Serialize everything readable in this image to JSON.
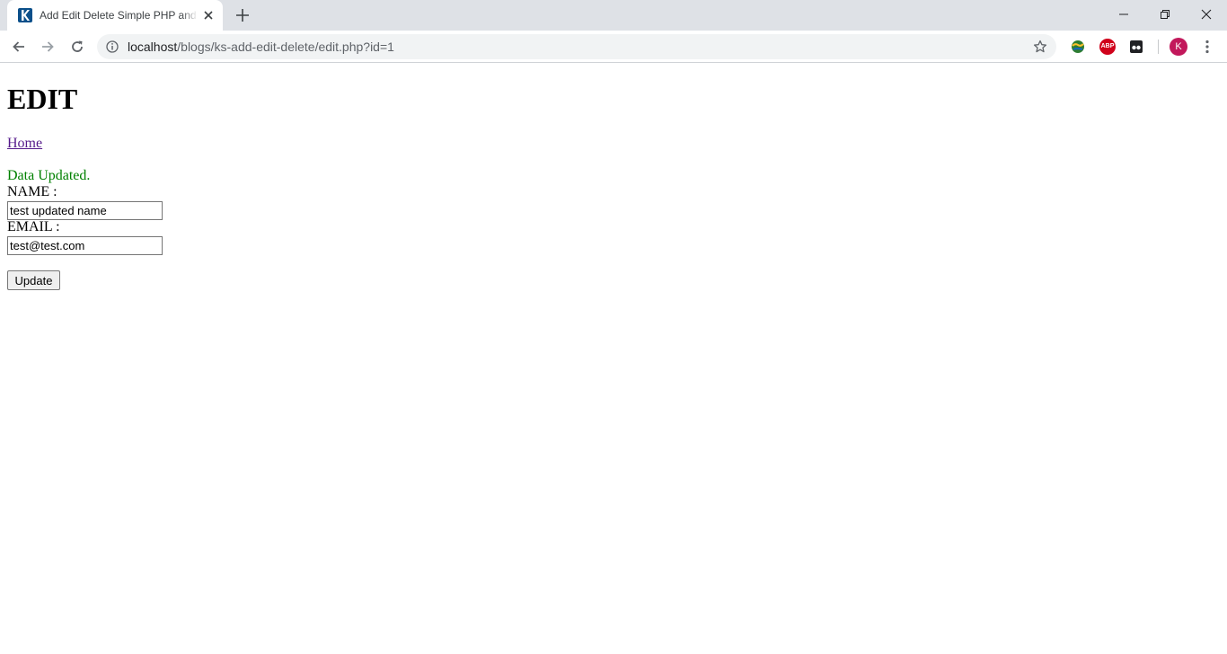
{
  "browser": {
    "tab_title": "Add Edit Delete Simple PHP and MySQL",
    "url_host": "localhost",
    "url_path": "/blogs/ks-add-edit-delete/edit.php?id=1",
    "avatar_initial": "K",
    "abp_label": "ABP",
    "icons": {
      "favicon": "k-logo-icon",
      "back": "arrow-left-icon",
      "forward": "arrow-right-icon",
      "reload": "reload-icon",
      "info": "info-icon",
      "bookmark": "star-icon",
      "new_tab": "plus-icon",
      "close_tab": "close-icon",
      "menu": "kebab-menu-icon"
    }
  },
  "page": {
    "title": "EDIT",
    "home_link": "Home",
    "status_message": "Data Updated.",
    "status_color": "#008000",
    "form": {
      "name_label": "NAME :",
      "name_value": "test updated name",
      "email_label": "EMAIL :",
      "email_value": "test@test.com",
      "submit_label": "Update"
    }
  }
}
